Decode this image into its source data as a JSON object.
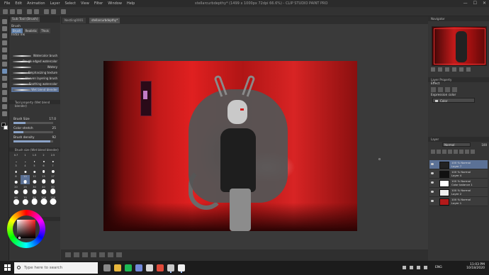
{
  "window": {
    "menu": [
      "File",
      "Edit",
      "Animation",
      "Layer",
      "Select",
      "View",
      "Filter",
      "Window",
      "Help"
    ],
    "title": "stellarcurbdepthy* (1499 x 1000px 72dpi 66.6%) - CLIP STUDIO PAINT PRO",
    "controls": [
      "—",
      "☐",
      "✕"
    ]
  },
  "subtool_panel": {
    "tabs": [
      "Sub Tool (Brush)"
    ],
    "group": "Brush",
    "subtabs": [
      "Brush",
      "Realistic",
      "Thick"
    ],
    "category": "India ink",
    "brushes": [
      {
        "label": "Watercolor brush",
        "selected": false
      },
      {
        "label": "Rough edged watercolor",
        "selected": false
      },
      {
        "label": "Watery",
        "selected": false
      },
      {
        "label": "Emphasizing texture",
        "selected": false
      },
      {
        "label": "Uneven layering brush",
        "selected": false
      },
      {
        "label": "Soothing watercolor",
        "selected": false
      },
      {
        "label": "Wet blend blender",
        "selected": true
      }
    ]
  },
  "tool_property": {
    "header": "Tool property (Wet blend blender)",
    "props": [
      {
        "label": "Brush Size",
        "value": "17.0",
        "fill": 0.3
      },
      {
        "label": "Color stretch",
        "value": "25",
        "fill": 0.25
      },
      {
        "label": "Brush density",
        "value": "92",
        "fill": 0.92
      }
    ]
  },
  "brush_size": {
    "header": "Brush size (Wet blend blender)",
    "sizes": [
      "0.7",
      "1",
      "1.5",
      "2",
      "2.5",
      "3",
      "4",
      "5",
      "6",
      "7",
      "8",
      "10",
      "12",
      "15",
      "17",
      "20",
      "25",
      "30",
      "40",
      "50",
      "60",
      "70",
      "80",
      "100",
      "120"
    ],
    "selected": "10"
  },
  "document_tabs": [
    "Nestling0001",
    "stellarcurbdepthy*"
  ],
  "active_document": "stellarcurbdepthy*",
  "navigator": {
    "header": "Navigator"
  },
  "layer_property": {
    "header": "Layer Property",
    "effect_label": "Effect",
    "expression_label": "Expression color",
    "expression_value": "Color"
  },
  "layer_panel": {
    "header": "Layer",
    "blend_mode": "Normal",
    "opacity": "100",
    "layers": [
      {
        "line1": "100 % Normal",
        "line2": "Layer 7",
        "selected": true,
        "thumb": "#222222"
      },
      {
        "line1": "100 % Normal",
        "line2": "Layer 4",
        "selected": false,
        "thumb": "#111111"
      },
      {
        "line1": "100 % Normal",
        "line2": "Color balance 1",
        "selected": false,
        "thumb": "#ffffff"
      },
      {
        "line1": "100 % Normal",
        "line2": "Layer 2",
        "selected": false,
        "thumb": "#eeeeee"
      },
      {
        "line1": "100 % Normal",
        "line2": "Layer 1",
        "selected": false,
        "thumb": "#b31a1a"
      }
    ]
  },
  "taskbar": {
    "search_placeholder": "Type here to search",
    "apps": [
      {
        "name": "task-view-icon",
        "color": "#888888"
      },
      {
        "name": "file-explorer-icon",
        "color": "#e8b73c"
      },
      {
        "name": "spotify-icon",
        "color": "#1db954"
      },
      {
        "name": "discord-icon",
        "color": "#7289da"
      },
      {
        "name": "mail-icon",
        "color": "#d8d8d8"
      },
      {
        "name": "chrome-icon",
        "color": "#e04a3a"
      },
      {
        "name": "clip-studio-icon",
        "color": "#c8c8c8"
      },
      {
        "name": "clip-studio-paint-icon",
        "color": "#f0f0f0"
      }
    ],
    "language": "ENG",
    "time": "11:03 PM",
    "date": "10/18/2020"
  }
}
